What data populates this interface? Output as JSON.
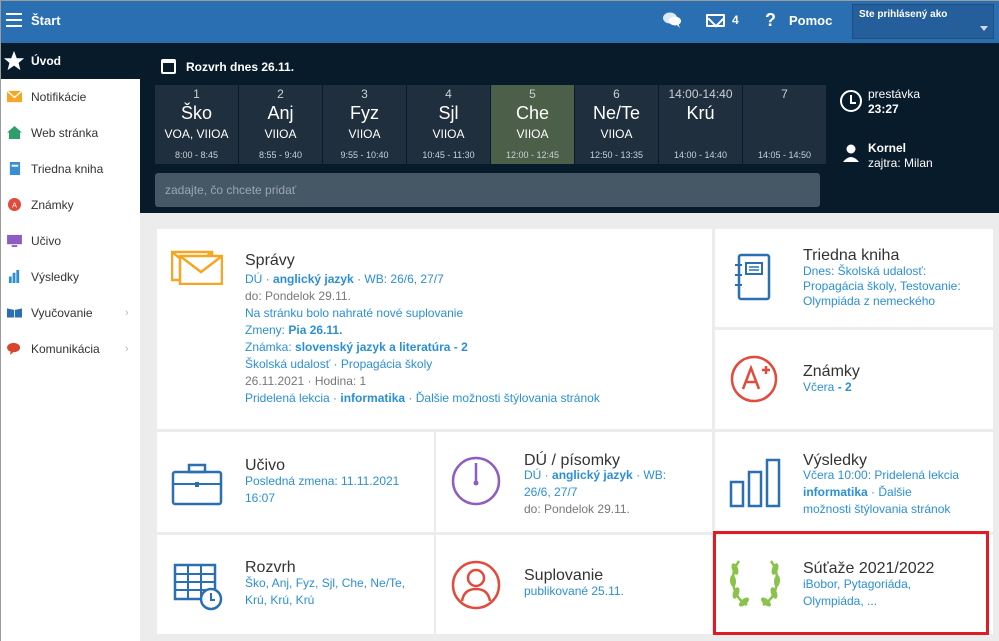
{
  "topbar": {
    "brand": "Štart",
    "chat_icon": "chat-icon",
    "mail_count": "4",
    "help_label": "Pomoc",
    "user_label": "Ste prihlásený ako"
  },
  "sidebar": {
    "items": [
      {
        "label": "Úvod",
        "icon": "star-icon"
      },
      {
        "label": "Notifikácie",
        "icon": "envelope-icon"
      },
      {
        "label": "Web stránka",
        "icon": "home-icon"
      },
      {
        "label": "Triedna kniha",
        "icon": "book-icon"
      },
      {
        "label": "Známky",
        "icon": "grade-icon"
      },
      {
        "label": "Učivo",
        "icon": "monitor-icon"
      },
      {
        "label": "Výsledky",
        "icon": "chart-icon"
      },
      {
        "label": "Vyučovanie",
        "icon": "open-book-icon"
      },
      {
        "label": "Komunikácia",
        "icon": "speech-icon"
      }
    ]
  },
  "schedule": {
    "title": "Rozvrh dnes 26.11.",
    "periods": [
      {
        "num": "1",
        "subject": "Ško",
        "classes": "VOA, VIIOA",
        "time": "8:00 - 8:45"
      },
      {
        "num": "2",
        "subject": "Anj",
        "classes": "VIIOA",
        "time": "8:55 - 9:40"
      },
      {
        "num": "3",
        "subject": "Fyz",
        "classes": "VIIOA",
        "time": "9:55 - 10:40"
      },
      {
        "num": "4",
        "subject": "Sjl",
        "classes": "VIIOA",
        "time": "10:45 - 11:30"
      },
      {
        "num": "5",
        "subject": "Che",
        "classes": "VIIOA",
        "time": "12:00 - 12:45"
      },
      {
        "num": "6",
        "subject": "Ne/Te",
        "classes": "VIIOA",
        "time": "12:50 - 13:35"
      },
      {
        "num": "14:00-14:40",
        "subject": "Krú",
        "classes": "",
        "time": "14:00 - 14:40"
      },
      {
        "num": "7",
        "subject": "",
        "classes": "",
        "time": "14:05 - 14:50"
      }
    ],
    "break_label": "prestávka",
    "break_time": "23:27",
    "teacher_name": "Kornel",
    "teacher_next": "zajtra: Milan",
    "search_placeholder": "zadajte, čo chcete pridať"
  },
  "tiles": {
    "spravy": {
      "title": "Správy",
      "l1a": "DÚ",
      "l1b": "anglický jazyk",
      "l1c": "WB: 26/6, 27/7",
      "l2": "do: Pondelok 29.11.",
      "l3": "Na stránku bolo nahraté nové suplovanie",
      "l4a": "Zmeny:",
      "l4b": "Pia 26.11.",
      "l5a": "Známka:",
      "l5b": "slovenský jazyk a literatúra",
      "l5c": "- 2",
      "l6a": "Školská udalosť",
      "l6b": "Propagácia školy",
      "l7a": "26.11.2021",
      "l7b": "Hodina: 1",
      "l8a": "Pridelená lekcia",
      "l8b": "informatika",
      "l8c": "Ďalšie možnosti štýlovania stránok"
    },
    "triedna": {
      "title": "Triedna kniha",
      "l1": "Dnes: Školská udalosť:",
      "l2": "Propagácia školy, Testovanie:",
      "l3": "Olympiáda z nemeckého"
    },
    "znamky": {
      "title": "Známky",
      "l1a": "Včera",
      "l1b": "- 2"
    },
    "ucivo": {
      "title": "Učivo",
      "l1": "Posledná zmena: 11.11.2021",
      "l2": "16:07"
    },
    "du": {
      "title": "DÚ / písomky",
      "l1a": "DÚ",
      "l1b": "anglický jazyk",
      "l1c": "WB:",
      "l2": "26/6, 27/7",
      "l3": "do: Pondelok 29.11."
    },
    "vysledky": {
      "title": "Výsledky",
      "l1": "Včera 10:00: Pridelená lekcia",
      "l2a": "informatika",
      "l2b": "Ďalšie",
      "l3": "možnosti štýlovania stránok"
    },
    "rozvrh": {
      "title": "Rozvrh",
      "l1": "Ško, Anj, Fyz, Sjl, Che, Ne/Te,",
      "l2": "Krú, Krú, Krú"
    },
    "suplovanie": {
      "title": "Suplovanie",
      "l1": "publikované 25.11."
    },
    "sutaze": {
      "title": "Súťaže 2021/2022",
      "l1": "iBobor, Pytagoriáda,",
      "l2": "Olympiáda, ..."
    }
  },
  "colors": {
    "topbar": "#2b6fb3",
    "dark": "#071b2b",
    "link": "#2b8fd7",
    "highlight": "#e01b24"
  }
}
